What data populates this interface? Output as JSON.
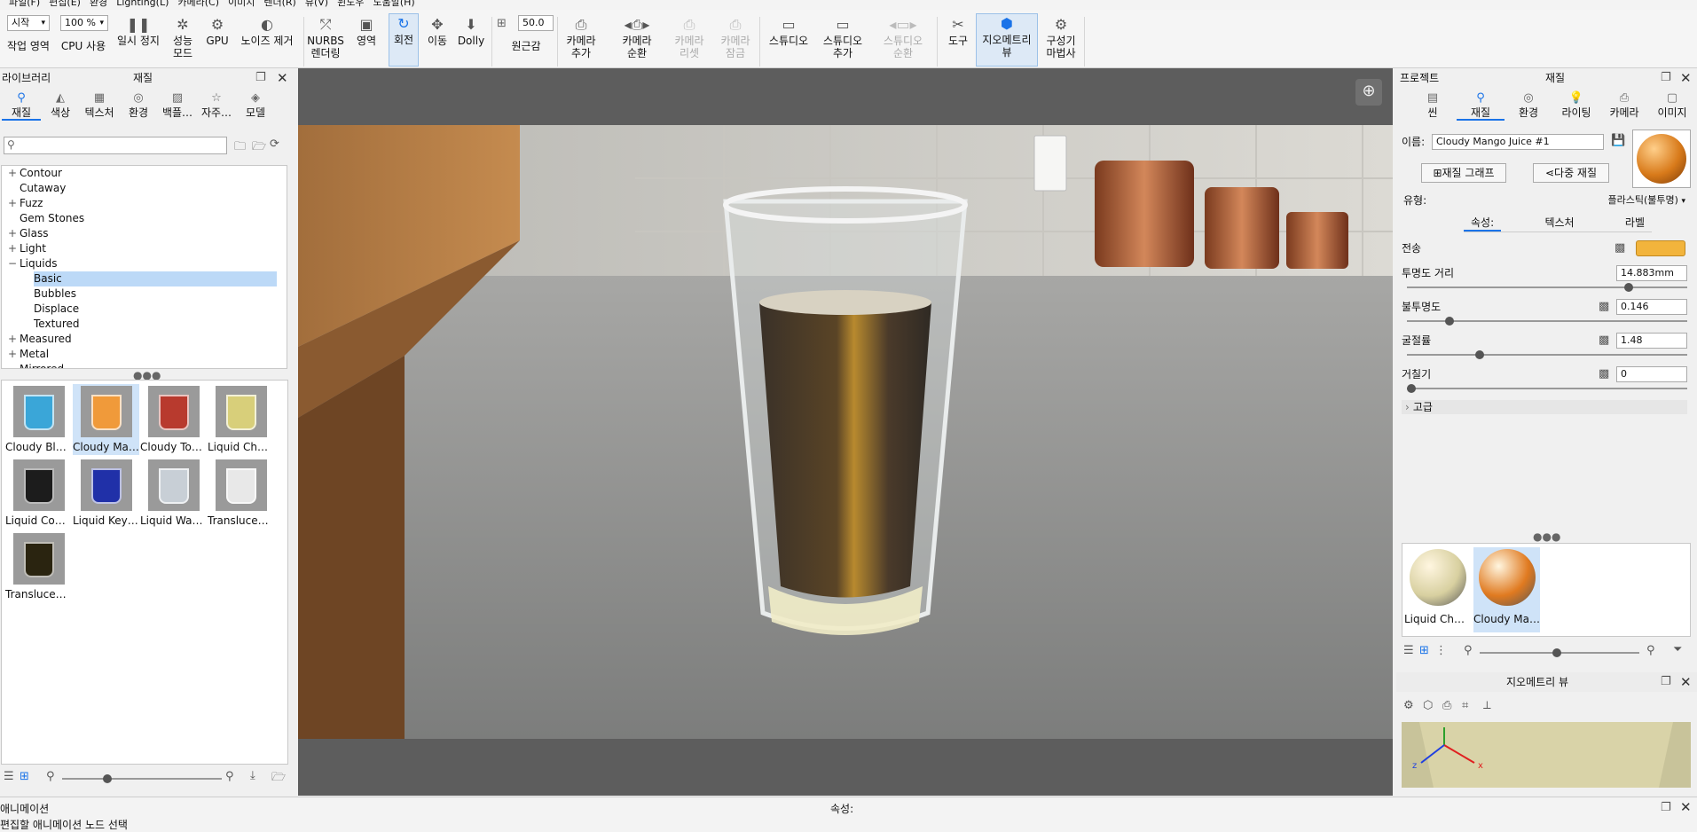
{
  "menu": [
    "파일(F)",
    "편집(E)",
    "환경",
    "Lighting(L)",
    "카메라(C)",
    "이미지",
    "렌더(R)",
    "뷰(V)",
    "윈도우",
    "도움말(H)"
  ],
  "toolbar": {
    "start_combo": "시작",
    "zoom_combo": "100 %",
    "fov_value": "50.0",
    "buttons": {
      "work_area": "작업 영역",
      "cpu": "CPU 사용",
      "pause": "일시 정지",
      "perf_mode_1": "성능",
      "perf_mode_2": "모드",
      "gpu": "GPU",
      "denoise": "노이즈 제거",
      "nurbs_1": "NURBS",
      "nurbs_2": "렌더링",
      "region": "영역",
      "rotate": "회전",
      "move": "이동",
      "dolly": "Dolly",
      "perspective": "원근감",
      "add_camera_1": "카메라",
      "add_camera_2": "추가",
      "camera_cycle_1": "카메라",
      "camera_cycle_2": "순환",
      "camera_reset_1": "카메라",
      "camera_reset_2": "리셋",
      "camera_lock_1": "카메라",
      "camera_lock_2": "잠금",
      "studio": "스튜디오",
      "add_studio_1": "스튜디오",
      "add_studio_2": "추가",
      "studio_cycle_1": "스튜디오",
      "studio_cycle_2": "순환",
      "tools": "도구",
      "geometry_view_1": "지오메트리",
      "geometry_view_2": "뷰",
      "config_wizard_1": "구성기",
      "config_wizard_2": "마법사"
    }
  },
  "library": {
    "header_left": "라이브러리",
    "header_title": "재질",
    "tabs": [
      "재질",
      "색상",
      "텍스처",
      "환경",
      "백플…",
      "자주…",
      "모델"
    ],
    "search_placeholder": "",
    "tree": [
      {
        "label": "Contour",
        "pm": "+",
        "indent": 0
      },
      {
        "label": "Cutaway",
        "pm": "",
        "indent": 0
      },
      {
        "label": "Fuzz",
        "pm": "+",
        "indent": 0
      },
      {
        "label": "Gem Stones",
        "pm": "",
        "indent": 0
      },
      {
        "label": "Glass",
        "pm": "+",
        "indent": 0
      },
      {
        "label": "Light",
        "pm": "+",
        "indent": 0
      },
      {
        "label": "Liquids",
        "pm": "−",
        "indent": 0
      },
      {
        "label": "Basic",
        "pm": "",
        "indent": 1,
        "selected": true
      },
      {
        "label": "Bubbles",
        "pm": "",
        "indent": 1
      },
      {
        "label": "Displace",
        "pm": "",
        "indent": 1
      },
      {
        "label": "Textured",
        "pm": "",
        "indent": 1
      },
      {
        "label": "Measured",
        "pm": "+",
        "indent": 0
      },
      {
        "label": "Metal",
        "pm": "+",
        "indent": 0
      },
      {
        "label": "Mirrored",
        "pm": "",
        "indent": 0
      }
    ],
    "materials": [
      {
        "label": "Cloudy Blue…",
        "color": "#3aa6d8"
      },
      {
        "label": "Cloudy Man…",
        "color": "#f09a3a",
        "selected": true
      },
      {
        "label": "Cloudy Tom…",
        "color": "#b83a2e"
      },
      {
        "label": "Liquid Char…",
        "color": "#d8cf7a"
      },
      {
        "label": "Liquid Coffee",
        "color": "#1c1c1c"
      },
      {
        "label": "Liquid KeyS…",
        "color": "#2030a8"
      },
      {
        "label": "Liquid Water",
        "color": "#c8cfd6"
      },
      {
        "label": "Translucent …",
        "color": "#e8e8e8"
      },
      {
        "label": "Translucent …",
        "color": "#2a2410"
      }
    ]
  },
  "project": {
    "header_left": "프로젝트",
    "header_title": "재질",
    "tabs": [
      "씬",
      "재질",
      "환경",
      "라이팅",
      "카메라",
      "이미지"
    ],
    "name_label": "이름:",
    "name_value": "Cloudy Mango Juice #1",
    "graph_button": "재질 그래프",
    "multi_button": "다중 재질",
    "type_label": "유형:",
    "type_value": "플라스틱(불투명)",
    "subtabs": [
      "속성:",
      "텍스처",
      "라벨"
    ],
    "props": [
      {
        "label": "전송",
        "value": ""
      },
      {
        "label": "투명도 거리",
        "value": "14.883mm",
        "slider": 0.8
      },
      {
        "label": "불투명도",
        "value": "0.146",
        "slider": 0.14
      },
      {
        "label": "굴절률",
        "value": "1.48",
        "slider": 0.25
      },
      {
        "label": "거칠기",
        "value": "0",
        "slider": 0.0
      }
    ],
    "advanced": "고급",
    "transmit_color": "#f2b43c",
    "scene_materials": [
      {
        "label": "Liquid Cha…",
        "color": "#d8d0a0"
      },
      {
        "label": "Cloudy Ma…",
        "color": "#e07a20",
        "selected": true
      }
    ]
  },
  "geometry_view": {
    "title": "지오메트리 뷰",
    "axes": [
      "z",
      "x"
    ]
  },
  "animation": {
    "header": "애니메이션",
    "center": "속성:",
    "hint": "편집할 애니메이션 노드 선택"
  }
}
